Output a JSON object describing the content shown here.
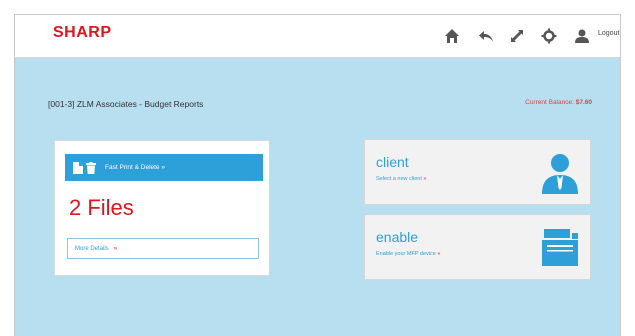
{
  "header": {
    "brand": "SHARP",
    "logout_label": "Logout",
    "icons": [
      "home-icon",
      "back-icon",
      "switch-icon",
      "settings-icon",
      "user-icon"
    ]
  },
  "context": {
    "title": "[001-3] ZLM Associates - Budget Reports",
    "client_account_label": "Current Balance:",
    "client_account_value": "$7.60"
  },
  "files_card": {
    "header_label": "Fast Print & Delete »",
    "count_label": "2 Files",
    "more_details_label": "More Details",
    "more_details_arrow": "»"
  },
  "tiles": {
    "client": {
      "title": "client",
      "subtitle": "Select a new client",
      "arrow": "»"
    },
    "enable": {
      "title": "enable",
      "subtitle": "Enable your MFP device",
      "arrow": "»"
    }
  },
  "colors": {
    "brand_red": "#e0141e",
    "accent_blue": "#2d9fd9",
    "page_bg": "#b7dff0"
  }
}
